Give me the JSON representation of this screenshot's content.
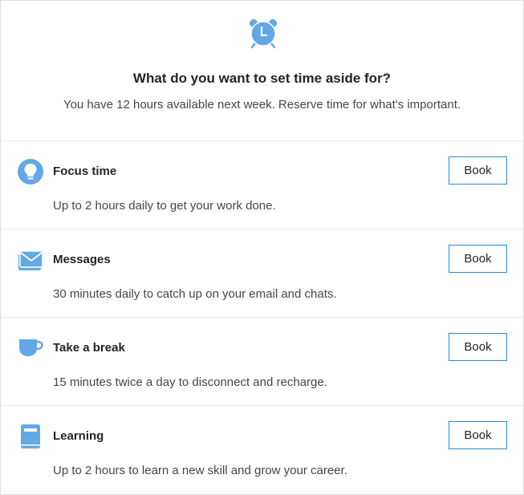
{
  "accent_color": "#62a8e5",
  "header": {
    "icon": "alarm-clock-icon",
    "title": "What do you want to set time aside for?",
    "subtitle": "You have 12 hours available next week. Reserve time for what's important."
  },
  "options": [
    {
      "icon": "lightbulb-icon",
      "title": "Focus time",
      "description": "Up to 2 hours daily to get your work done.",
      "button_label": "Book"
    },
    {
      "icon": "envelope-icon",
      "title": "Messages",
      "description": "30 minutes daily to catch up on your email and chats.",
      "button_label": "Book"
    },
    {
      "icon": "cup-icon",
      "title": "Take a break",
      "description": "15 minutes twice a day to disconnect and recharge.",
      "button_label": "Book"
    },
    {
      "icon": "book-icon",
      "title": "Learning",
      "description": "Up to 2 hours to learn a new skill and grow your career.",
      "button_label": "Book"
    }
  ]
}
